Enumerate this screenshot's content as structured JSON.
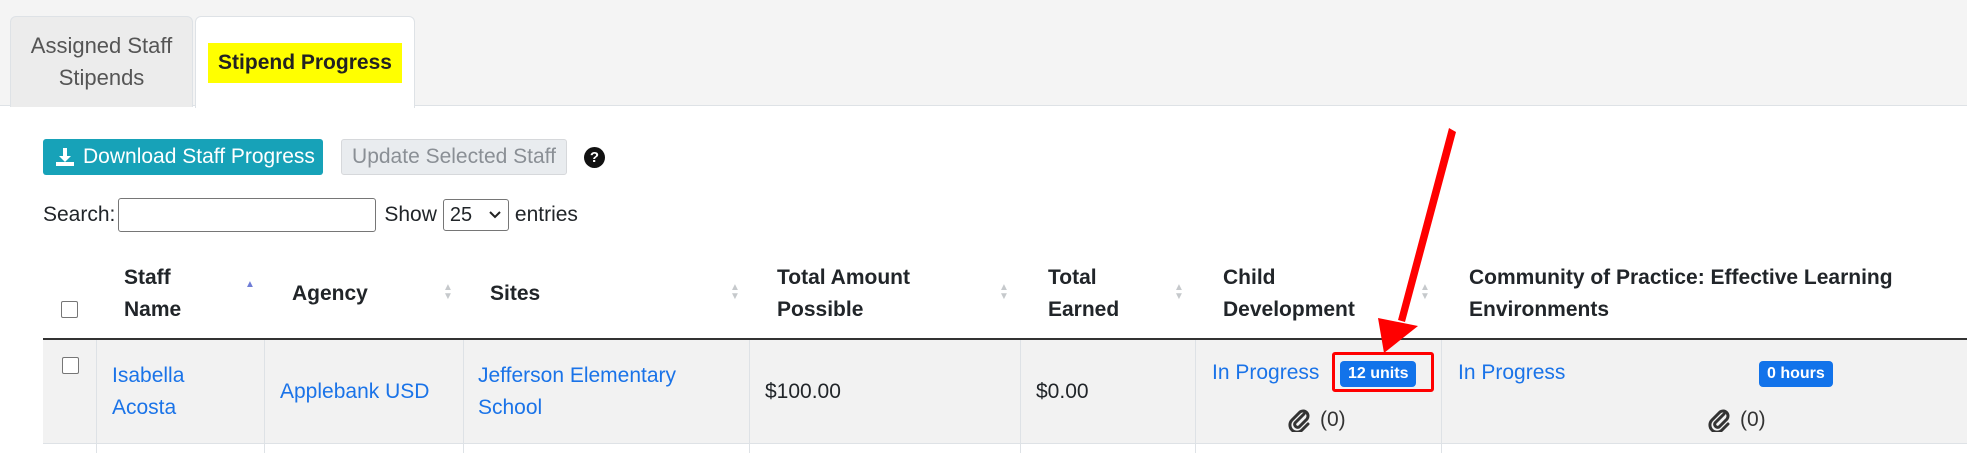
{
  "tabs": [
    {
      "label_line1": "Assigned Staff",
      "label_line2": "Stipends"
    },
    {
      "label": "Stipend Progress"
    }
  ],
  "toolbar": {
    "download_label": "Download Staff Progress",
    "update_label": "Update Selected Staff",
    "help_symbol": "?"
  },
  "search": {
    "label": "Search:",
    "value": "",
    "show_label": "Show",
    "entries_value": "25",
    "entries_label": "entries"
  },
  "table": {
    "headers": {
      "staff_name_1": "Staff",
      "staff_name_2": "Name",
      "agency": "Agency",
      "sites": "Sites",
      "total_possible_1": "Total Amount",
      "total_possible_2": "Possible",
      "total_earned_1": "Total",
      "total_earned_2": "Earned",
      "child_dev_1": "Child",
      "child_dev_2": "Development",
      "cop_1": "Community of Practice: Effective Learning",
      "cop_2": "Environments"
    },
    "rows": [
      {
        "name_1": "Isabella",
        "name_2": "Acosta",
        "agency": "Applebank USD",
        "site_1": "Jefferson Elementary",
        "site_2": "School",
        "total_possible": "$100.00",
        "total_earned": "$0.00",
        "child_dev_status": "In Progress",
        "child_dev_badge": "12 units",
        "child_dev_attachments": "(0)",
        "cop_status": "In Progress",
        "cop_badge": "0 hours",
        "cop_attachments": "(0)"
      }
    ]
  },
  "colors": {
    "accent": "#17a2b8",
    "link": "#1a73e8",
    "badge": "#1273ea",
    "highlight": "#ffff00",
    "annotation": "#ff0000"
  }
}
